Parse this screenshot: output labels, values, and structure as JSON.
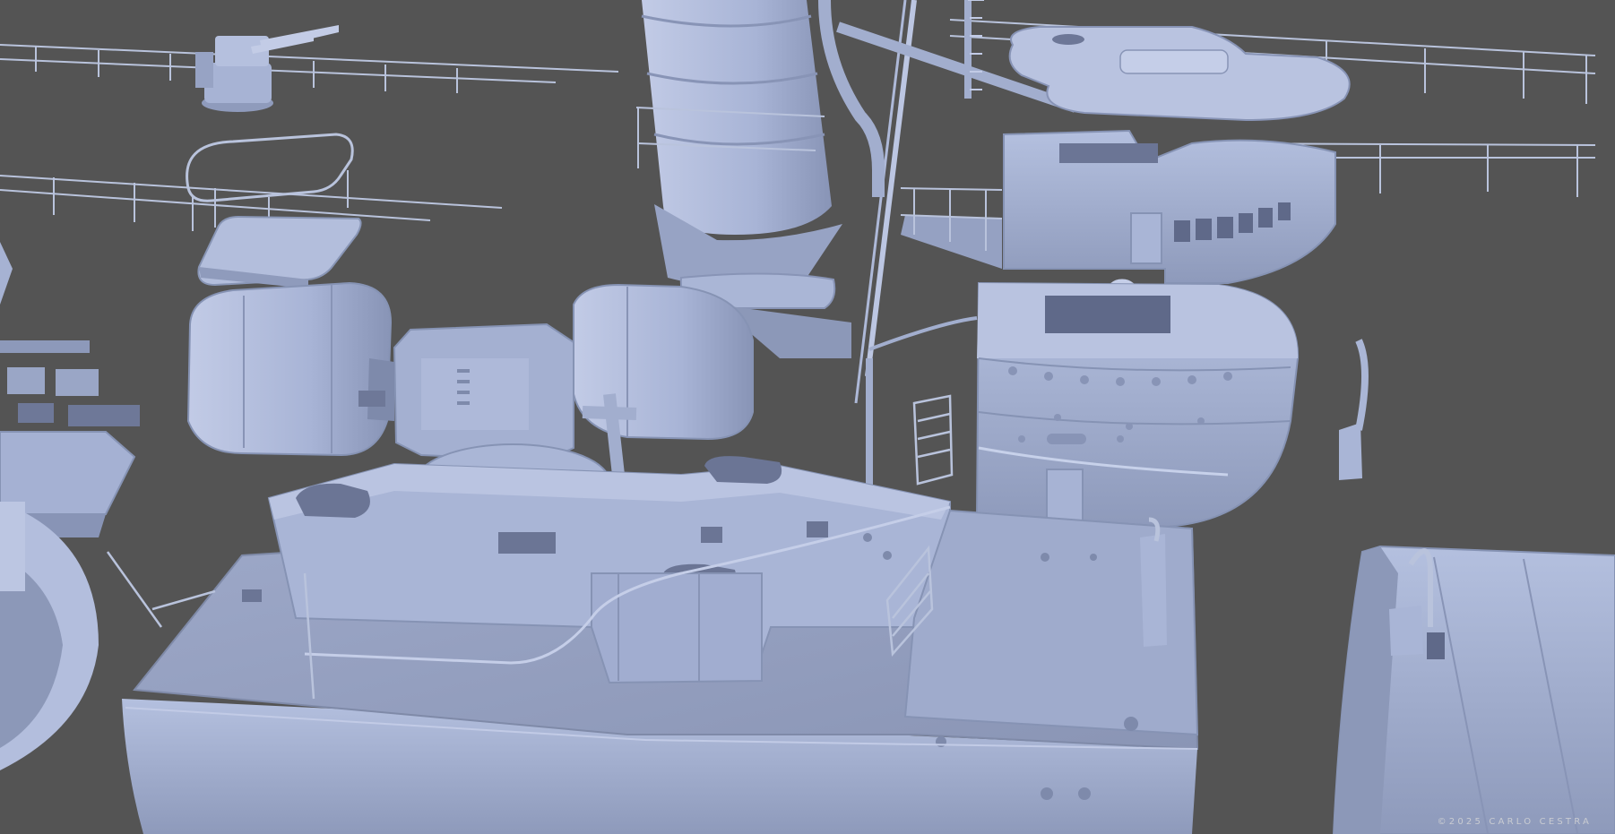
{
  "scene": {
    "background": "#545454",
    "model_color": "#a9b6d8",
    "model_shadow": "#7f8aa8",
    "model_highlight": "#c7d1ea",
    "rail_color": "#b9c3dc"
  },
  "watermark": {
    "copyright": "©2025 CARLO CESTRA"
  }
}
